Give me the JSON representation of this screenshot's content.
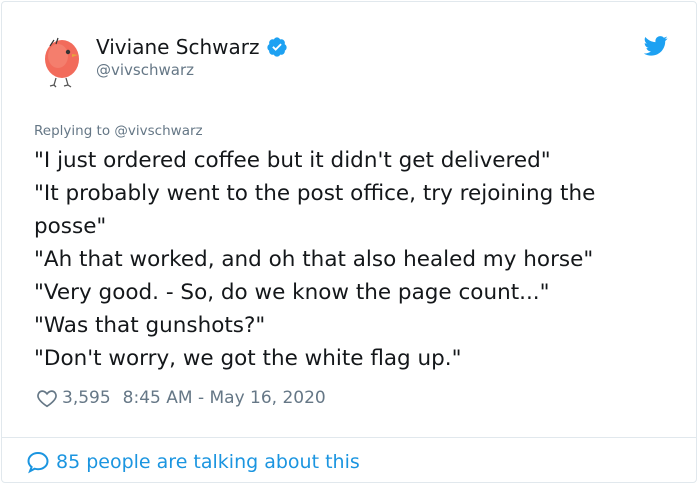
{
  "tweet": {
    "author": {
      "display_name": "Viviane Schwarz",
      "handle": "@vivschwarz",
      "verified": true
    },
    "replying_prefix": "Replying to",
    "replying_to": "@vivschwarz",
    "lines": [
      "\"I just ordered coffee but it didn't get delivered\"",
      "\"It probably went to the post office, try rejoining the",
      "posse\"",
      "\"Ah that worked, and oh that also healed my horse\"",
      "\"Very good. - So, do we know the page count...\"",
      "\"Was that gunshots?\"",
      "\"Don't worry, we got the white flag up.\""
    ],
    "like_count": "3,595",
    "timestamp": "8:45 AM - May 16, 2020",
    "talking_text": "85 people are talking about this"
  },
  "colors": {
    "twitter_blue": "#1da1f2",
    "link_blue": "#1b95e0",
    "muted_gray": "#657786",
    "text_dark": "#14171a",
    "border": "#e1e8ed"
  },
  "icons": {
    "avatar": "red-bird-avatar",
    "verified": "verified-badge-icon",
    "brand": "twitter-bird-icon",
    "like": "heart-icon",
    "reply": "speech-bubble-icon"
  }
}
